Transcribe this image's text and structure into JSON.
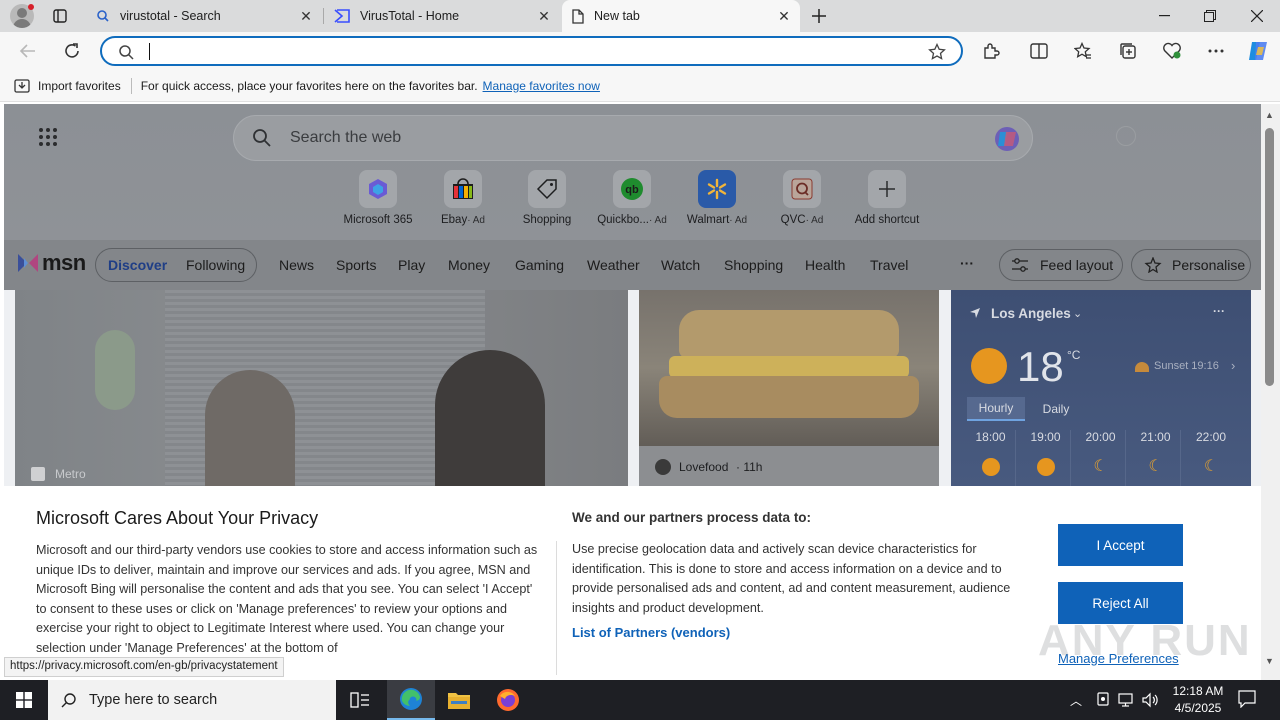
{
  "tabs": [
    {
      "label": "virustotal - Search"
    },
    {
      "label": "VirusTotal - Home"
    },
    {
      "label": "New tab"
    }
  ],
  "toolbar": {
    "address_value": ""
  },
  "favorites_bar": {
    "import_label": "Import favorites",
    "hint": "For quick access, place your favorites here on the favorites bar.",
    "manage_link": "Manage favorites now"
  },
  "newtab": {
    "search_placeholder": "Search the web",
    "quick_links": [
      {
        "label": "Microsoft 365",
        "ad": ""
      },
      {
        "label": "Ebay",
        "ad": "· Ad"
      },
      {
        "label": "Shopping",
        "ad": ""
      },
      {
        "label": "Quickbo...",
        "ad": "· Ad"
      },
      {
        "label": "Walmart",
        "ad": "· Ad"
      },
      {
        "label": "QVC",
        "ad": "· Ad"
      },
      {
        "label": "Add shortcut",
        "ad": ""
      }
    ]
  },
  "msn": {
    "logo": "msn",
    "nav": [
      "Discover",
      "Following",
      "News",
      "Sports",
      "Play",
      "Money",
      "Gaming",
      "Weather",
      "Watch",
      "Shopping",
      "Health",
      "Travel"
    ],
    "more": "···",
    "feed_layout": "Feed layout",
    "personalise": "Personalise",
    "card_left_source": "Metro",
    "card_mid_source": "Lovefood",
    "card_mid_time": "· 11h",
    "weather": {
      "location": "Los Angeles",
      "temp": "18",
      "unit": "°C",
      "sunset": "Sunset 19:16",
      "tab_hourly": "Hourly",
      "tab_daily": "Daily",
      "hours": [
        "18:00",
        "19:00",
        "20:00",
        "21:00",
        "22:00"
      ]
    }
  },
  "privacy": {
    "title": "Microsoft Cares About Your Privacy",
    "body": "Microsoft and our third-party vendors use cookies to store and access information such as unique IDs to deliver, maintain and improve our services and ads. If you agree, MSN and Microsoft Bing will personalise the content and ads that you see. You can select 'I Accept' to consent to these uses or click on 'Manage preferences' to review your options and exercise your right to object to Legitimate Interest where used. You can change your selection under 'Manage Preferences' at the bottom of",
    "partners_heading": "We and our partners process data to:",
    "partners_text": "Use precise geolocation data and actively scan device characteristics for identification. This is done to store and access information on a device and to provide personalised ads and content, ad and content measurement, audience insights and product development.",
    "partners_link": "List of Partners (vendors)",
    "accept": "I Accept",
    "reject": "Reject All",
    "manage": "Manage Preferences"
  },
  "status_url": "https://privacy.microsoft.com/en-gb/privacystatement",
  "watermark": "ANY RUN",
  "taskbar": {
    "search_placeholder": "Type here to search",
    "time": "12:18 AM",
    "date": "4/5/2025"
  }
}
